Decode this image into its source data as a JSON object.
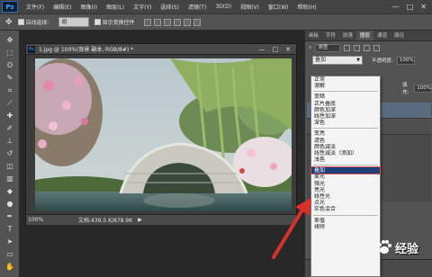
{
  "menubar": {
    "logo": "Ps",
    "items": [
      "文件(F)",
      "编辑(E)",
      "图像(I)",
      "图层(L)",
      "文字(Y)",
      "选择(S)",
      "滤镜(T)",
      "3D(D)",
      "视图(V)",
      "窗口(W)",
      "帮助(H)"
    ],
    "minimize": "—",
    "maximize": "□",
    "close": "✕"
  },
  "optionsbar": {
    "auto_select_label": "自动选择：",
    "auto_select_value": "组",
    "show_transform_label": "显示变换控件"
  },
  "document": {
    "title": "1.jpg @ 100%(背景 副本, RGB/8#) *",
    "zoom": "100%",
    "doc_size": "文档:439.5 K/878.9K",
    "status_arrow": "▶",
    "close": "✕",
    "minimize": "—",
    "restore": "□"
  },
  "layers_panel": {
    "tabs": [
      "画板",
      "字符",
      "段落",
      "图层",
      "通道",
      "路径"
    ],
    "active_tab": "图层",
    "kind_label": "类型",
    "blend_mode": "叠加",
    "opacity_label": "不透明度:",
    "opacity_value": "100%",
    "fill_label": "填充:",
    "fill_value": "100%"
  },
  "blend_modes": {
    "group1": [
      "正常",
      "溶解"
    ],
    "group2": [
      "变暗",
      "正片叠底",
      "颜色加深",
      "线性加深",
      "深色"
    ],
    "group3": [
      "变亮",
      "滤色",
      "颜色减淡",
      "线性减淡（添加）",
      "浅色"
    ],
    "group4": [
      "叠加",
      "柔光",
      "强光",
      "亮光",
      "线性光",
      "点光",
      "实色混合"
    ],
    "group5": [
      "差值",
      "排除"
    ],
    "selected": "叠加"
  },
  "watermark": {
    "text": "经验",
    "logo": "Bai"
  },
  "colors": {
    "accent_red": "#d9302b",
    "selection_blue": "#1f3f78"
  }
}
